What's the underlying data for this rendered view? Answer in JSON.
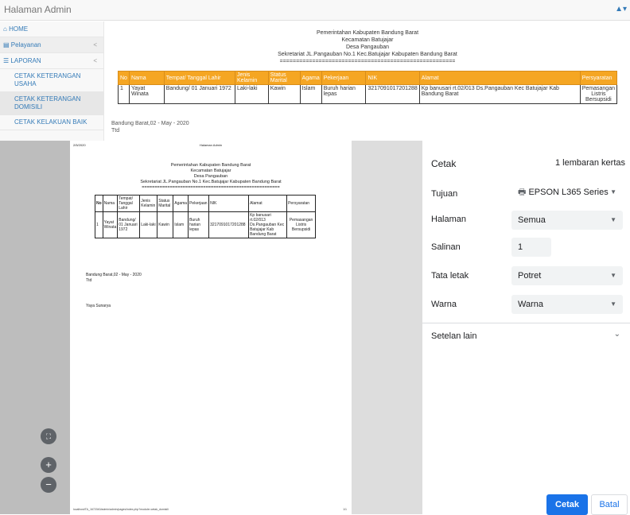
{
  "app": {
    "title": "Halaman Admin",
    "user_icon": "▲▾"
  },
  "sidebar": {
    "items": [
      {
        "icon": "home-icon",
        "label": "HOME",
        "chevron": ""
      },
      {
        "icon": "chart-icon",
        "label": "Pelayanan",
        "chevron": "<"
      },
      {
        "icon": "users-icon",
        "label": "LAPORAN",
        "chevron": "<"
      }
    ],
    "subitems": [
      "CETAK KETERANGAN USAHA",
      "CETAK KETERANGAN DOMISILI",
      "CETAK KELAKUAN BAIK"
    ]
  },
  "report": {
    "header_lines": [
      "Pemerintahan Kabupaten Bandung Barat",
      "Kecamatan Batujajar",
      "Desa Pangauban",
      "Sekretariat JL.Pangauban No.1 Kec.Batujajar Kabupaten Bandung Barat",
      "======================================================"
    ],
    "columns": [
      "No",
      "Nama",
      "Tempat/ Tanggal Lahir",
      "Jenis Kelamin",
      "Status Marital",
      "Agama",
      "Pekerjaan",
      "NIK",
      "Alamat",
      "Persyaratan"
    ],
    "row": [
      "1",
      "Yayat Winata",
      "Bandung/ 01 Januari 1972",
      "Laki-laki",
      "Kawin",
      "Islam",
      "Buruh harian lepas",
      "3217091017201288",
      "Kp banusari rt.02/013 Ds.Pangauban Kec Batujajar Kab Bandung Barat",
      "Pemasangan Listris Bersupsidi"
    ],
    "footer_place": "Bandung Barat,02 - May - 2020",
    "footer_ttd": "Ttd",
    "signer": "Yaya Sunarya"
  },
  "print_page": {
    "date": "2/5/2020",
    "header_center": "Halaman Admin",
    "url": "localhost/TA_1672040/admin/admin/pages/index.php?module=cetak_domisili",
    "page_num": "1/1"
  },
  "preview_controls": {
    "fit_icon": "⛶",
    "zoom_in_icon": "+",
    "zoom_out_icon": "−"
  },
  "print_dialog": {
    "title": "Cetak",
    "sheets": "1 lembaran kertas",
    "rows": [
      {
        "label": "Tujuan",
        "value": "EPSON L365 Series",
        "type": "select"
      },
      {
        "label": "Halaman",
        "value": "Semua",
        "type": "select"
      },
      {
        "label": "Salinan",
        "value": "1",
        "type": "input"
      },
      {
        "label": "Tata letak",
        "value": "Potret",
        "type": "select"
      },
      {
        "label": "Warna",
        "value": "Warna",
        "type": "select"
      }
    ],
    "more_settings": "Setelan lain",
    "print_button": "Cetak",
    "cancel_button": "Batal"
  },
  "colors": {
    "table_header": "#f5a623",
    "primary": "#1a73e8",
    "preview_bg": "#dddddd"
  }
}
